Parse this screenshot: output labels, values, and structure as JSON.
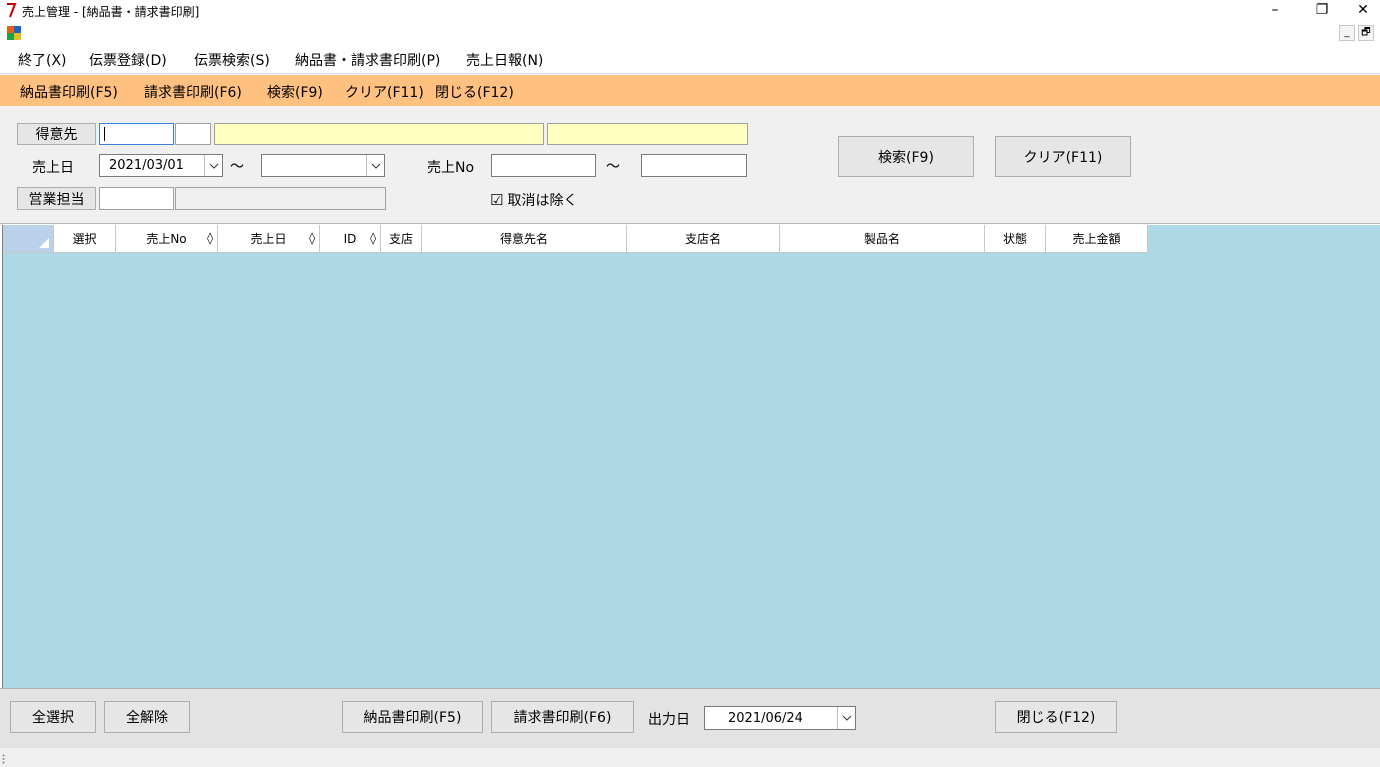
{
  "window": {
    "title": "売上管理 - [納品書・請求書印刷]",
    "minimize": "–",
    "restore": "❐",
    "close": "✕",
    "mdi_minimize": "_",
    "mdi_restore": "🗗"
  },
  "menubar": [
    "終了(X)",
    "伝票登録(D)",
    "伝票検索(S)",
    "納品書・請求書印刷(P)",
    "売上日報(N)"
  ],
  "toolbar": [
    "納品書印刷(F5)",
    "請求書印刷(F6)",
    "検索(F9)",
    "クリア(F11)",
    "閉じる(F12)"
  ],
  "search": {
    "customer_button": "得意先",
    "sales_date_label": "売上日",
    "sales_date_from": "2021/03/01",
    "tilde": "～",
    "sales_no_label": "売上No",
    "staff_button": "営業担当",
    "exclude_cancel_label": "取消は除く",
    "exclude_cancel_mark": "☑",
    "search_button": "検索(F9)",
    "clear_button": "クリア(F11)"
  },
  "grid": {
    "columns": [
      "選択",
      "売上No",
      "売上日",
      "ID",
      "支店",
      "得意先名",
      "支店名",
      "製品名",
      "状態",
      "売上金額"
    ],
    "sort_glyph": "◊"
  },
  "bottom": {
    "select_all": "全選択",
    "deselect_all": "全解除",
    "print_delivery": "納品書印刷(F5)",
    "print_invoice": "請求書印刷(F6)",
    "output_date_label": "出力日",
    "output_date": "2021/06/24",
    "close": "閉じる(F12)"
  }
}
